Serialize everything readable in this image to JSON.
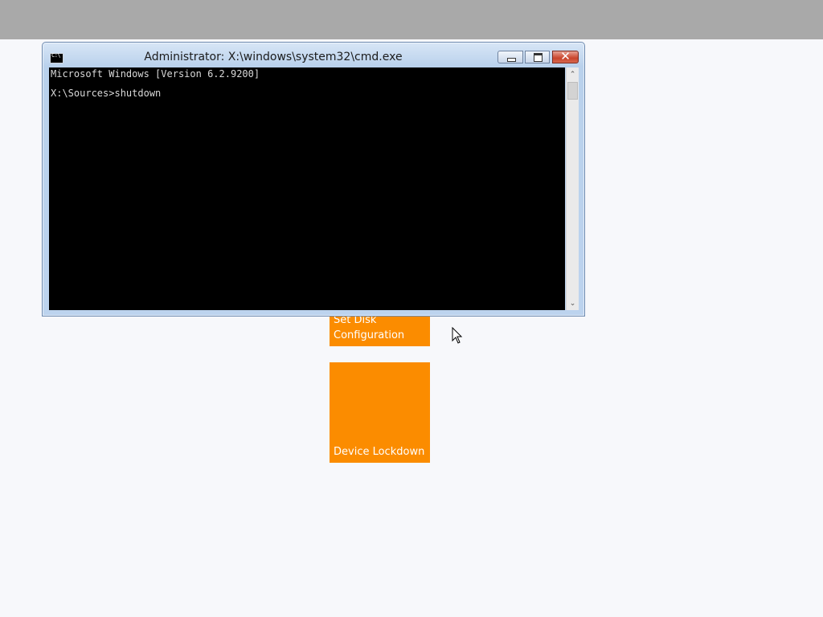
{
  "window": {
    "title": "Administrator: X:\\windows\\system32\\cmd.exe",
    "icon_text": "C:\\",
    "close_glyph": "✕",
    "scroll_up_glyph": "⌃",
    "scroll_down_glyph": "⌄"
  },
  "console": {
    "lines": [
      "Microsoft Windows [Version 6.2.9200]",
      "",
      "X:\\Sources>shutdown"
    ]
  },
  "tiles": {
    "disk": {
      "label": "Set Disk\nConfiguration"
    },
    "lockdown": {
      "label": "Device Lockdown"
    }
  },
  "colors": {
    "tile": "#fb8c00",
    "console_bg": "#000000",
    "top_bar": "#a9a9a9",
    "page_bg": "#f7f8fb"
  },
  "icons": {
    "cmd": "cmd-icon",
    "minimize": "minimize-icon",
    "maximize": "maximize-icon",
    "close": "close-icon",
    "pointer": "mouse-pointer-icon"
  }
}
